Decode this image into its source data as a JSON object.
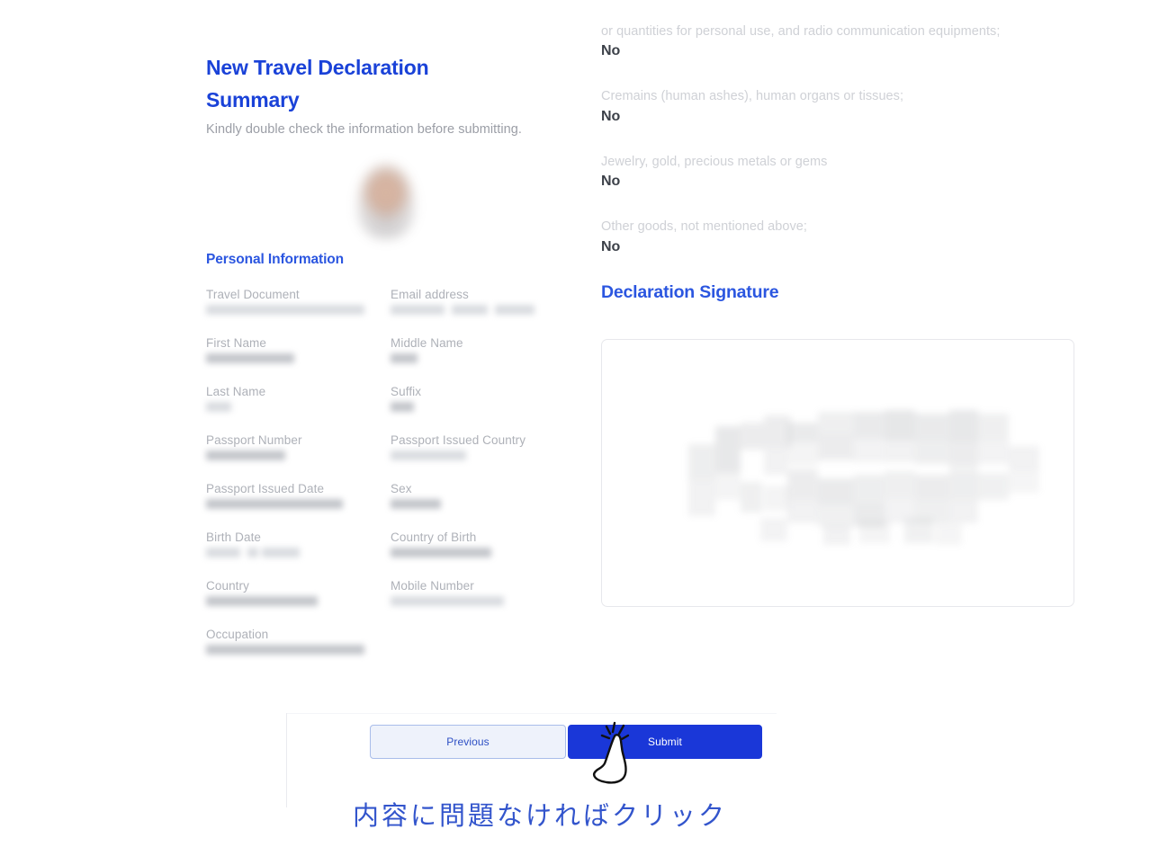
{
  "header": {
    "title": "New Travel Declaration Summary",
    "subtitle": "Kindly double check the information before submitting."
  },
  "personal_information": {
    "heading": "Personal Information",
    "fields": [
      {
        "label": "Travel Document",
        "value": "",
        "redacted": true
      },
      {
        "label": "Email address",
        "value": "",
        "redacted": true
      },
      {
        "label": "First Name",
        "value": "",
        "redacted": true
      },
      {
        "label": "Middle Name",
        "value": "",
        "redacted": true
      },
      {
        "label": "Last Name",
        "value": "",
        "redacted": true
      },
      {
        "label": "Suffix",
        "value": "",
        "redacted": true
      },
      {
        "label": "Passport Number",
        "value": "",
        "redacted": true
      },
      {
        "label": "Passport Issued Country",
        "value": "",
        "redacted": true
      },
      {
        "label": "Passport Issued Date",
        "value": "",
        "redacted": true
      },
      {
        "label": "Sex",
        "value": "",
        "redacted": true
      },
      {
        "label": "Birth Date",
        "value": "",
        "redacted": true
      },
      {
        "label": "Country of Birth",
        "value": "",
        "redacted": true
      },
      {
        "label": "Country",
        "value": "",
        "redacted": true
      },
      {
        "label": "Mobile Number",
        "value": "",
        "redacted": true
      },
      {
        "label": "Occupation",
        "value": "",
        "redacted": true
      }
    ]
  },
  "declaration_questions": [
    {
      "question": "or quantities for personal use, and radio communication equipments;",
      "answer": "No"
    },
    {
      "question": "Cremains (human ashes), human organs or tissues;",
      "answer": "No"
    },
    {
      "question": "Jewelry, gold, precious metals or gems",
      "answer": "No"
    },
    {
      "question": "Other goods, not mentioned above;",
      "answer": "No"
    }
  ],
  "signature": {
    "heading": "Declaration Signature",
    "content": ""
  },
  "footer": {
    "previous_label": "Previous",
    "submit_label": "Submit"
  },
  "annotation": {
    "text": "内容に問題なければクリック",
    "color": "#3355cc"
  },
  "colors": {
    "brand_blue": "#1a42d8",
    "heading_blue": "#2b56e0",
    "submit_bg": "#1a37d8",
    "previous_bg": "#eef2fb",
    "previous_border": "#a9bdea",
    "label_gray": "#aeb1b8",
    "question_gray": "#cfd1d6",
    "answer_dark": "#3c4149"
  }
}
